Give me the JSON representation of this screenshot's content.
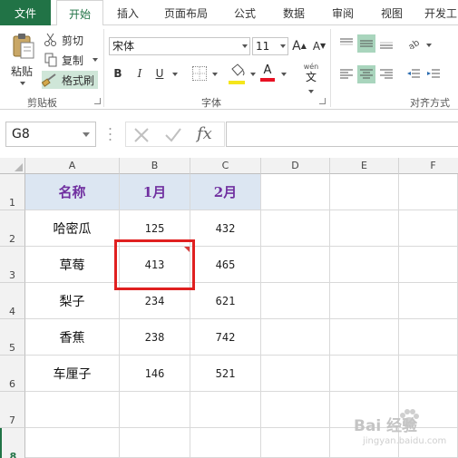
{
  "tabs": [
    "文件",
    "开始",
    "插入",
    "页面布局",
    "公式",
    "数据",
    "审阅",
    "视图",
    "开发工"
  ],
  "active_tab": "开始",
  "clipboard": {
    "paste_label": "粘贴",
    "cut_label": "剪切",
    "copy_label": "复制",
    "format_painter_label": "格式刷",
    "group_label": "剪贴板"
  },
  "font": {
    "font_name": "宋体",
    "font_size": "11",
    "grow_label": "A",
    "shrink_label": "A",
    "bold": "B",
    "italic": "I",
    "underline": "U",
    "font_color_glyph": "A",
    "phonetic_top": "wén",
    "phonetic_bottom": "文",
    "group_label": "字体",
    "fill_color": "#f5e61b",
    "font_color": "#e81123"
  },
  "alignment": {
    "group_label": "对齐方式"
  },
  "formula_bar": {
    "name_box": "G8",
    "fx_label": "fx",
    "formula": ""
  },
  "columns": [
    "A",
    "B",
    "C",
    "D",
    "E",
    "F"
  ],
  "rows": [
    "1",
    "2",
    "3",
    "4",
    "5",
    "6",
    "7",
    "8"
  ],
  "table": {
    "headers": [
      "名称",
      "1月",
      "2月"
    ],
    "rows": [
      [
        "哈密瓜",
        "125",
        "432"
      ],
      [
        "草莓",
        "413",
        "465"
      ],
      [
        "梨子",
        "234",
        "621"
      ],
      [
        "香蕉",
        "238",
        "742"
      ],
      [
        "车厘子",
        "146",
        "521"
      ]
    ]
  },
  "watermark": {
    "main": "Bai 经验",
    "sub": "jingyan.baidu.com"
  }
}
